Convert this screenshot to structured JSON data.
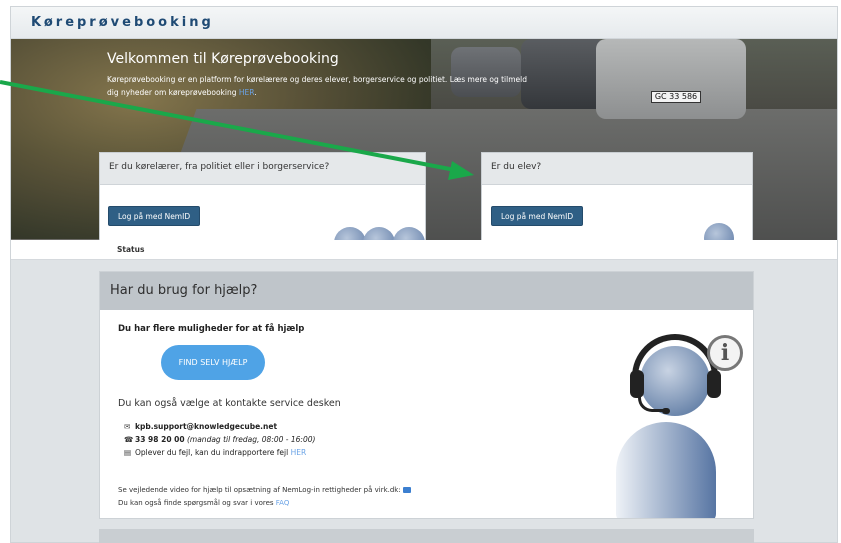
{
  "header": {
    "brand": "Køreprøvebooking"
  },
  "hero": {
    "title": "Velkommen til Køreprøvebooking",
    "text": "Køreprøvebooking er en platform for kørelærere og deres elever, borgerservice og politiet. Læs mere og tilmeld dig nyheder om køreprøvebooking ",
    "link": "HER",
    "plate": "GC 33 586"
  },
  "cards": [
    {
      "title": "Er du kørelærer, fra politiet eller i borgerservice?",
      "button": "Log på med NemID"
    },
    {
      "title": "Er du elev?",
      "button": "Log på med NemID"
    }
  ],
  "status_bar": {
    "label": "Status"
  },
  "help": {
    "title": "Har du brug for hjælp?",
    "subtitle": "Du har flere muligheder for at få hjælp",
    "find_button": "FIND SELV HJÆLP",
    "contact_intro": "Du kan også vælge at kontakte service desken",
    "email": "kpb.support@knowledgecube.net",
    "phone": "33 98 20 00",
    "phone_hours": "(mandag til fredag, 08:00 - 16:00)",
    "report_text": "Oplever du fejl, kan du indrapportere fejl ",
    "report_link": "HER",
    "video_text": "Se vejledende video for hjælp til opsætning af NemLog-in rettigheder på virk.dk:",
    "faq_text": "Du kan også finde spørgsmål og svar i vores ",
    "faq_link": "FAQ"
  },
  "icons": {
    "email": "envelope-icon",
    "phone": "phone-icon",
    "report": "document-icon",
    "video": "video-icon",
    "info": "info-icon",
    "agent": "headset-person-icon"
  },
  "colors": {
    "nemid_button": "#2f5f85",
    "find_button": "#4fa3e6",
    "annotation_arrow": "#1aa84a",
    "brand": "#1f4a74"
  }
}
